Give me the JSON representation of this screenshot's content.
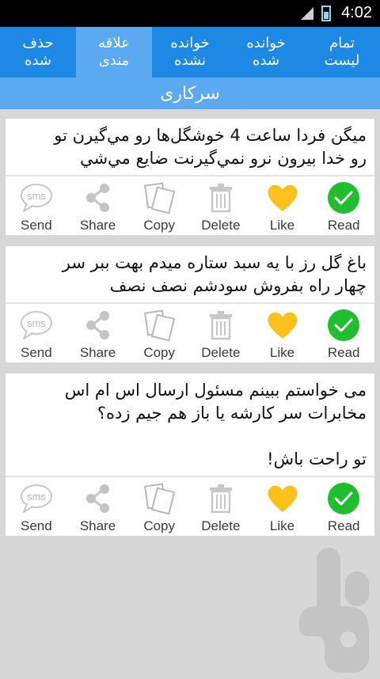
{
  "status": {
    "time": "4:02"
  },
  "tabs": [
    {
      "label": "تمام\nلیست",
      "active": false
    },
    {
      "label": "خوانده\nشده",
      "active": false
    },
    {
      "label": "خوانده\nنشده",
      "active": false
    },
    {
      "label": "علاقه\nمندی",
      "active": true
    },
    {
      "label": "حذف\nشده",
      "active": false
    }
  ],
  "header": {
    "title": "سرکاری"
  },
  "actions": {
    "send": "Send",
    "share": "Share",
    "copy": "Copy",
    "delete": "Delete",
    "like": "Like",
    "read": "Read"
  },
  "messages": [
    {
      "text": "ميگن فردا ساعت 4 خوشگل‌ها رو مي‌گيرن تو\nرو خدا بيرون نرو نمي‌گيرنت ضايع مي‌شي"
    },
    {
      "text": "باغ گل رز با یه سبد ستاره میدم بهت ببر سر\nچهار راه بفروش سودشم نصف نصف"
    },
    {
      "text": "می خواستم ببینم مسئول ارسال اس ام اس\nمخابرات سر کارشه یا باز هم جیم زده؟\n\nتو راحت باش!"
    }
  ],
  "colors": {
    "tab_bar": "#1e88e5",
    "tab_active": "#5aa9f1",
    "like": "#fcc21b",
    "read": "#1fbe2f"
  }
}
